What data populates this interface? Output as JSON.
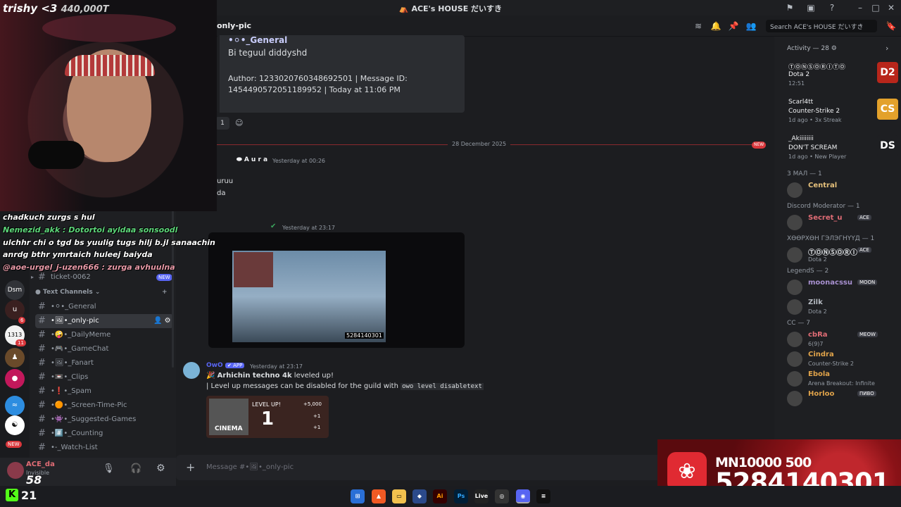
{
  "window": {
    "title": "ACE's HOUSE だいすき"
  },
  "chat_header": {
    "channel": "only-pic",
    "search_placeholder": "Search ACE's HOUSE だいすき"
  },
  "webcam": {
    "streamer": "trishy <3",
    "count": "440,000T"
  },
  "overlay_chat": [
    "chadkuch zurgs s hul",
    "Nemezid_akk : Dotortoi ayldaa sonsoodl",
    "ulchhr chi o tgd bs yuulig tugs hilj b.jl sanaachin",
    "anrdg bthr ymrtaich huleej baiyda",
    "@aoe-urgel_j-uzen666 : zurga avhuulna"
  ],
  "sidebar": {
    "ticket": "ticket-0062",
    "ticket_badge": "NEW",
    "category": "Text Channels",
    "channels": [
      "•⚪•_General",
      "•🖼•_only-pic",
      "•🤪•_DailyMeme",
      "•🎮•_GameChat",
      "•🖼•_Fanart",
      "•📼•_Clips",
      "•❗•_Spam",
      "•🟠•_Screen-Time-Pic",
      "•👾•_Suggested-Games",
      "•#️⃣•_Counting",
      "•-_Watch-List"
    ]
  },
  "rail": {
    "label": "Dsm",
    "badge_1": "6",
    "badge_2": "11",
    "new_badge": "NEW"
  },
  "user": {
    "name": "ACE_da",
    "status": "Invisible",
    "level": "58"
  },
  "messages": {
    "embed_author": "•⚪•_General",
    "embed_text": "Bi teguul diddyshd",
    "embed_meta": "Author: 1233020760348692501 | Message ID: 1454490572051189952 | Today at 11:06 PM",
    "reaction_count": "1",
    "date_divider": "28 December 2025",
    "new_label": "NEW",
    "aura_name": "A u r a",
    "aura_time": "Yesterday at 00:26",
    "aura_line1": "uruu",
    "aura_line2": "da",
    "img_time": "Yesterday at 23:17",
    "img_caption_num": "5284140301",
    "owo_name": "OwO",
    "owo_tag": "APP",
    "owo_time": "Yesterday at 23:17",
    "owo_line1_user": "Arhichin techno 4k",
    "owo_line1_rest": " leveled up!",
    "owo_line2": "| Level up messages can be disabled for the guild with ",
    "owo_code": "owo level disabletext",
    "card_name": "CINEMA",
    "card_level_label": "LEVEL UP!",
    "card_level": "1",
    "card_reward1": "+5,000",
    "card_reward2": "+1",
    "card_reward3": "+1"
  },
  "composer": {
    "placeholder": "Message #•🖼•_only-pic"
  },
  "members": {
    "activity_header": "Activity — 28",
    "activities": [
      {
        "name": "ⓉⓄⓃⓈⓄⓇⒾⓉⓄ",
        "game": "Dota 2",
        "sub": "12:51",
        "tile": "D2",
        "tile_bg": "#b8261b"
      },
      {
        "name": "Scarl4tt",
        "game": "Counter-Strike 2",
        "sub": "1d ago • 3x Streak",
        "tile": "CS",
        "tile_bg": "#e3a12b"
      },
      {
        "name": "_Akiiiiiiii",
        "game": "DON'T SCREAM",
        "sub": "1d ago • New Player",
        "tile": "DS",
        "tile_bg": "#1e1f22"
      }
    ],
    "groups": [
      {
        "header": "3 МАЛ — 1",
        "members": [
          {
            "name": "Central",
            "sub": "",
            "color": "#e5c07b"
          }
        ]
      },
      {
        "header": "Discord Moderator — 1",
        "members": [
          {
            "name": "Secret_u",
            "sub": "",
            "color": "#e06c75",
            "tag": "ACE"
          }
        ]
      },
      {
        "header": "ХӨӨРХӨН ГЭЛЭГНҮҮД — 1",
        "members": [
          {
            "name": "ⓉⓄⓃⓈⓄⓇⒾ",
            "sub": "Dota 2",
            "color": "#dbdee1",
            "tag": "ACE"
          }
        ]
      },
      {
        "header": "LegendS — 2",
        "members": [
          {
            "name": "moonacssu",
            "sub": "",
            "color": "#a890d0",
            "tag": "MOON"
          },
          {
            "name": "Zilk",
            "sub": "Dota 2",
            "color": "#b5bac1"
          }
        ]
      },
      {
        "header": "CC — 7",
        "members": [
          {
            "name": "cbRa",
            "sub": "6(9)7",
            "color": "#e06c75",
            "tag": "MEOW"
          },
          {
            "name": "Cindra",
            "sub": "Counter-Strike 2",
            "color": "#e0a34a"
          },
          {
            "name": "Ebola",
            "sub": "Arena Breakout: Infinite",
            "color": "#e0a34a"
          },
          {
            "name": "Horloo",
            "sub": "",
            "color": "#e0a34a",
            "tag": "ПИВО"
          }
        ]
      }
    ]
  },
  "donate": {
    "line1": "MN10000 500",
    "line2": "5284140301"
  },
  "taskbar": {
    "kick_count": "21"
  }
}
